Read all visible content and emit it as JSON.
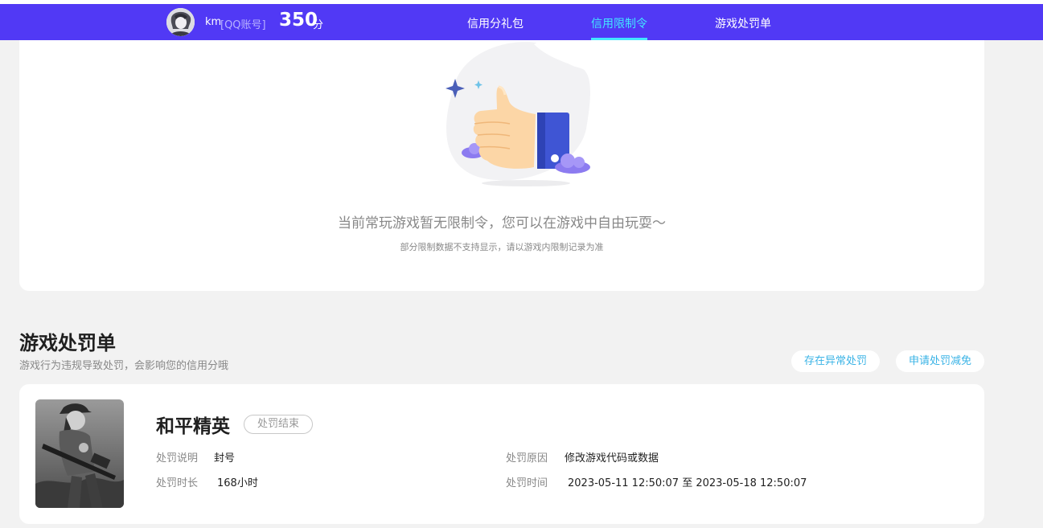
{
  "header": {
    "username": "km",
    "account_type": "[QQ账号]",
    "score": "350",
    "score_unit": "分",
    "nav": [
      {
        "label": "信用分礼包",
        "active": false
      },
      {
        "label": "信用限制令",
        "active": true
      },
      {
        "label": "游戏处罚单",
        "active": false
      }
    ]
  },
  "restriction_card": {
    "empty_message": "当前常玩游戏暂无限制令，您可以在游戏中自由玩耍～",
    "note": "部分限制数据不支持显示，请以游戏内限制记录为准"
  },
  "penalty_section": {
    "title": "游戏处罚单",
    "subtitle": "游戏行为违规导致处罚，会影响您的信用分哦",
    "buttons": {
      "abnormal": "存在异常处罚",
      "appeal": "申请处罚减免"
    }
  },
  "penalty_record": {
    "game": "和平精英",
    "status": "处罚结束",
    "desc_label": "处罚说明",
    "desc_value": "封号",
    "duration_label": "处罚时长",
    "duration_value": "168小时",
    "reason_label": "处罚原因",
    "reason_value": "修改游戏代码或数据",
    "time_label": "处罚时间",
    "time_value": "2023-05-11 12:50:07 至 2023-05-18 12:50:07"
  },
  "colors": {
    "header_bg": "#5139f5",
    "active_nav": "#42e8ff",
    "pill_text": "#3ab3e6",
    "page_bg": "#f2f2f2"
  },
  "icons": {
    "illustration": "thumbs-up-illustration",
    "avatar": "user-avatar",
    "game_cover": "game-cover-image"
  }
}
